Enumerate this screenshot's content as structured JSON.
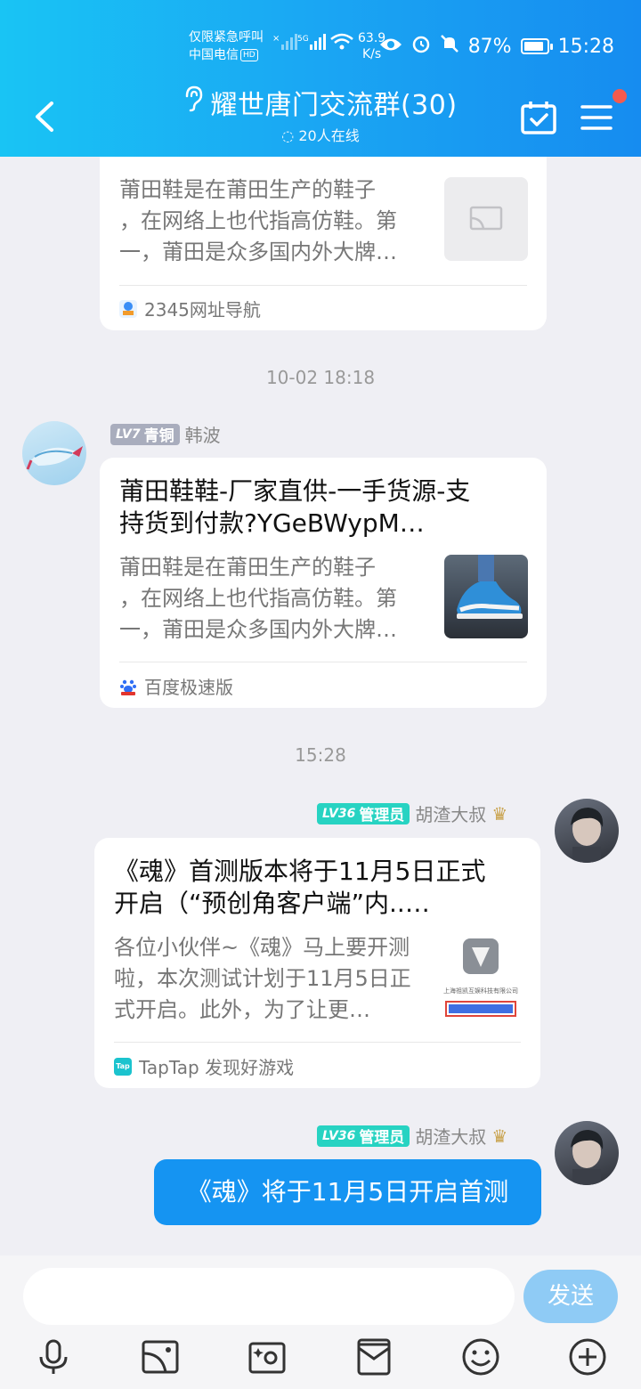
{
  "status_bar": {
    "carrier_line1": "仅限紧急呼叫",
    "carrier_line2": "中国电信",
    "hd": "HD",
    "speed_value": "63.9",
    "speed_unit": "K/s",
    "battery": "87%",
    "battery_level": 0.87,
    "time": "15:28"
  },
  "header": {
    "title": "耀世唐门交流群(30)",
    "online": "20人在线"
  },
  "messages": {
    "card1": {
      "desc": "莆田鞋是在莆田生产的鞋子，在网络上也代指高仿鞋。第一，莆田是众多国内外大牌…",
      "desc_lines": [
        "莆田鞋是在莆田生产的鞋子",
        "，在网络上也代指高仿鞋。第",
        "一，莆田是众多国内外大牌…"
      ],
      "source": "2345网址导航"
    },
    "time1": "10-02 18:18",
    "msg2": {
      "badge_lv": "LV7",
      "badge_title": "青铜",
      "sender": "韩波",
      "title_lines": [
        "莆田鞋鞋-厂家直供-一手货源-支",
        "持货到付款?YGeBWypM…"
      ],
      "desc_lines": [
        "莆田鞋是在莆田生产的鞋子",
        "，在网络上也代指高仿鞋。第",
        "一，莆田是众多国内外大牌…"
      ],
      "source": "百度极速版"
    },
    "time2": "15:28",
    "msg3": {
      "badge_lv": "LV36",
      "badge_title": "管理员",
      "sender": "胡渣大叔",
      "title_lines": [
        "《魂》首测版本将于11月5日正式",
        "开启（“预创角客户端”内..…"
      ],
      "desc_lines": [
        "各位小伙伴~《魂》马上要开测",
        "啦，本次测试计划于11月5日正",
        "式开启。此外，为了让更…"
      ],
      "thumb_text": "上海祖凯互娱科技有限公司",
      "source": "TapTap 发现好游戏"
    },
    "msg4": {
      "badge_lv": "LV36",
      "badge_title": "管理员",
      "sender": "胡渣大叔",
      "text": "《魂》将于11月5日开启首测"
    }
  },
  "input": {
    "send_label": "发送"
  },
  "colors": {
    "header_start": "#19c4f4",
    "header_end": "#168cf0",
    "bubble": "#1594f2",
    "send_disabled": "#8fcbf5",
    "admin_badge": "#27d3c2",
    "bronze_badge": "#a9adbd"
  },
  "icons": [
    "back-icon",
    "ear-icon",
    "calendar-check-icon",
    "menu-icon",
    "voice-icon",
    "image-icon",
    "camera-icon",
    "red-packet-icon",
    "emoji-icon",
    "plus-icon"
  ]
}
